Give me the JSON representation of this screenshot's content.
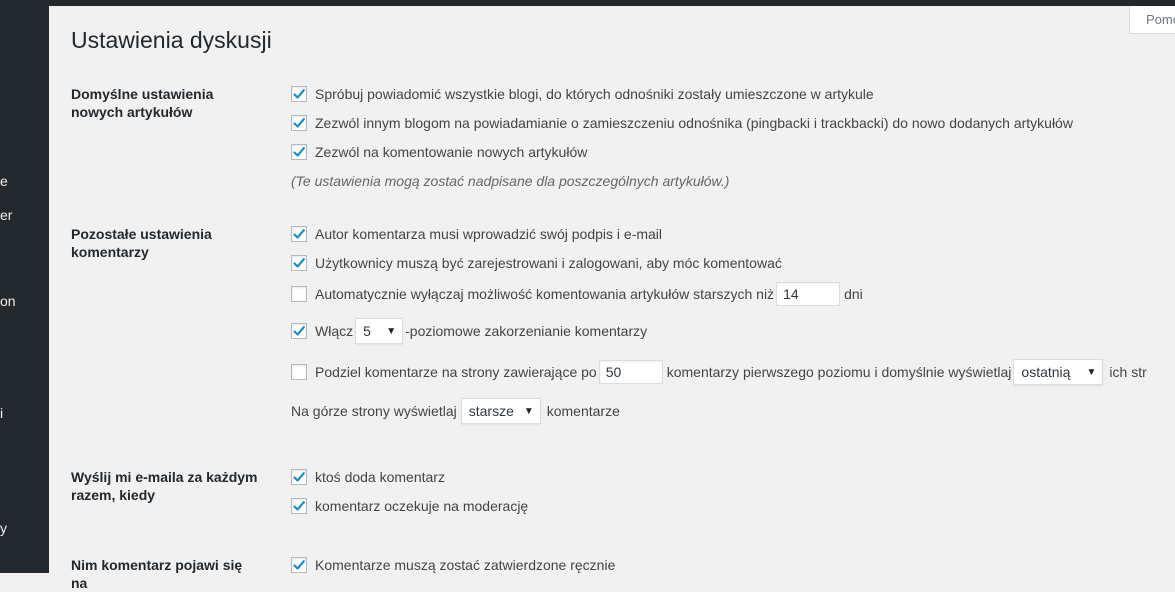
{
  "sidebar": {
    "fragments": [
      "e",
      "er",
      "on",
      "i",
      "y"
    ]
  },
  "help_tab": "Pomoc",
  "page_title": "Ustawienia dyskusji",
  "sections": {
    "default_article": {
      "label": "Domyślne ustawienia nowych artykułów",
      "opt_notify_blogs": "Spróbuj powiadomić wszystkie blogi, do których odnośniki zostały umieszczone w artykule",
      "opt_allow_pings": "Zezwól innym blogom na powiadamianie o zamieszczeniu odnośnika (pingbacki i trackbacki) do nowo dodanych artykułów",
      "opt_allow_comments": "Zezwól na komentowanie nowych artykułów",
      "note": "(Te ustawienia mogą zostać nadpisane dla poszczególnych artykułów.)"
    },
    "other_comments": {
      "label": "Pozostałe ustawienia komentarzy",
      "opt_require_name": "Autor komentarza musi wprowadzić swój podpis i e-mail",
      "opt_registration": "Użytkownicy muszą być zarejestrowani i zalogowani, aby móc komentować",
      "opt_close_pre": "Automatycznie wyłączaj możliwość komentowania artykułów starszych niż",
      "close_days_value": "14",
      "opt_close_post": "dni",
      "opt_thread_pre": "Włącz",
      "thread_depth_value": "5",
      "opt_thread_post": "-poziomowe zakorzenianie komentarzy",
      "opt_paged_pre": "Podziel komentarze na strony zawierające po",
      "per_page_value": "50",
      "opt_paged_mid": "komentarzy pierwszego poziomu i domyślnie wyświetlaj",
      "default_page_value": "ostatnią",
      "opt_paged_post": "ich str",
      "order_pre": "Na górze strony wyświetlaj",
      "order_value": "starsze",
      "order_post": "komentarze"
    },
    "email_me": {
      "label": "Wyślij mi e-maila za każdym razem, kiedy",
      "opt_new_comment": "ktoś doda komentarz",
      "opt_moderation": "komentarz oczekuje na moderację"
    },
    "before_appears": {
      "label": "Nim komentarz pojawi się na",
      "opt_manual_approval": "Komentarze muszą zostać zatwierdzone ręcznie"
    }
  },
  "colors": {
    "admin_dark": "#23282d",
    "background": "#f1f1f1",
    "check_blue": "#1e8cbe"
  }
}
